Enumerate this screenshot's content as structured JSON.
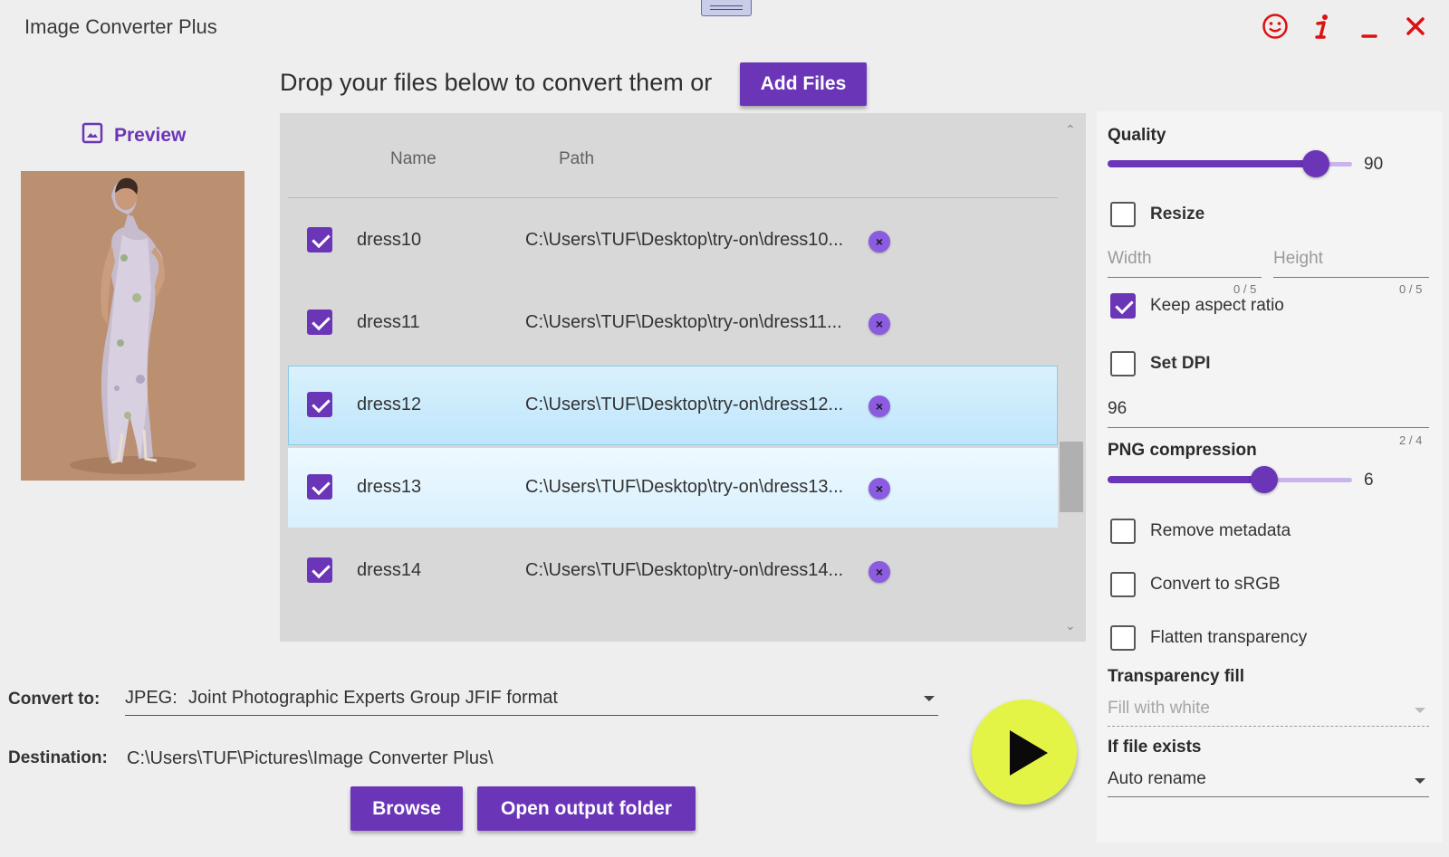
{
  "app": {
    "title": "Image Converter Plus"
  },
  "window_controls": [
    {
      "icon": "smiley-icon"
    },
    {
      "icon": "info-icon"
    },
    {
      "icon": "minimize-icon"
    },
    {
      "icon": "close-icon"
    }
  ],
  "drop": {
    "prompt": "Drop your files below to convert them or",
    "add_files_label": "Add Files"
  },
  "preview": {
    "label": "Preview",
    "icon": "image-icon"
  },
  "file_list": {
    "columns": {
      "name": "Name",
      "path": "Path"
    },
    "rows": [
      {
        "checked": true,
        "name": "dress10",
        "path": "C:\\Users\\TUF\\Desktop\\try-on\\dress10...",
        "remove": "×"
      },
      {
        "checked": true,
        "name": "dress11",
        "path": "C:\\Users\\TUF\\Desktop\\try-on\\dress11...",
        "remove": "×"
      },
      {
        "checked": true,
        "name": "dress12",
        "path": "C:\\Users\\TUF\\Desktop\\try-on\\dress12...",
        "remove": "×"
      },
      {
        "checked": true,
        "name": "dress13",
        "path": "C:\\Users\\TUF\\Desktop\\try-on\\dress13...",
        "remove": "×"
      },
      {
        "checked": true,
        "name": "dress14",
        "path": "C:\\Users\\TUF\\Desktop\\try-on\\dress14...",
        "remove": "×"
      }
    ],
    "selected_row": "dress12",
    "hover_row": "dress13"
  },
  "convert": {
    "label": "Convert to:",
    "format_code": "JPEG:",
    "format_name": "Joint Photographic Experts Group JFIF format"
  },
  "destination": {
    "label": "Destination:",
    "path": "C:\\Users\\TUF\\Pictures\\Image Converter Plus\\"
  },
  "buttons": {
    "browse": "Browse",
    "open_output": "Open output folder"
  },
  "settings": {
    "quality": {
      "label": "Quality",
      "value": "90",
      "level": 0.9
    },
    "resize": {
      "label": "Resize",
      "checked": false
    },
    "width": {
      "placeholder": "Width",
      "counter": "0 / 5"
    },
    "height": {
      "placeholder": "Height",
      "counter": "0 / 5"
    },
    "keep_aspect": {
      "label": "Keep aspect ratio",
      "checked": true
    },
    "set_dpi": {
      "label": "Set DPI",
      "checked": false
    },
    "dpi": {
      "value": "96",
      "counter": "2 / 4"
    },
    "png_compression": {
      "label": "PNG compression",
      "value": "6",
      "level": 0.67
    },
    "remove_metadata": {
      "label": "Remove metadata",
      "checked": false
    },
    "convert_srgb": {
      "label": "Convert to sRGB",
      "checked": false
    },
    "flatten_transparency": {
      "label": "Flatten transparency",
      "checked": false
    },
    "transparency_fill": {
      "label": "Transparency fill",
      "value": "Fill with white"
    },
    "if_file_exists": {
      "label": "If file exists",
      "value": "Auto rename"
    }
  },
  "colors": {
    "accent": "#6b35b8",
    "play": "#e4f447",
    "close": "#dd1111"
  }
}
